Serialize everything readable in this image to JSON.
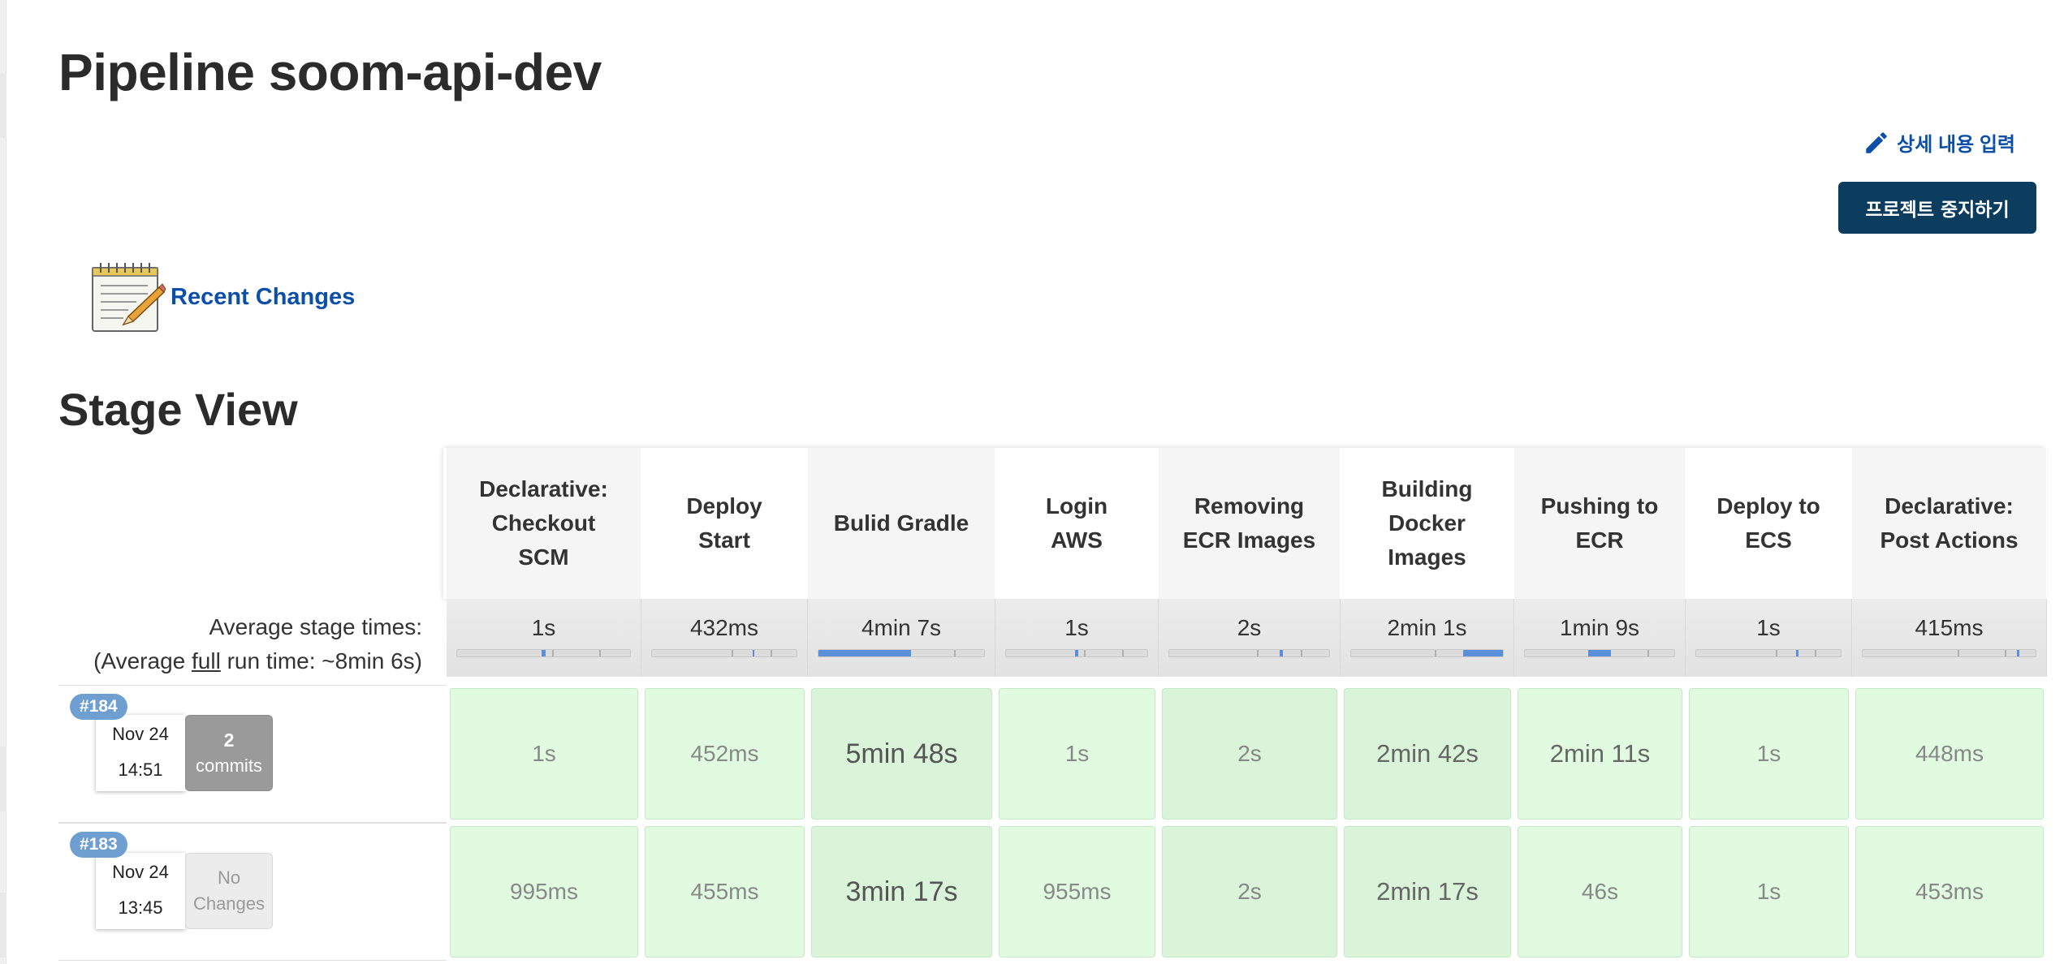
{
  "page": {
    "title": "Pipeline soom-api-dev",
    "edit_link": "상세 내용 입력",
    "stop_button": "프로젝트 중지하기",
    "recent_changes": "Recent Changes",
    "stage_view_title": "Stage View"
  },
  "averages": {
    "label": "Average stage times:",
    "full_prefix": "(Average ",
    "full_word": "full",
    "full_suffix": " run time: ~8min 6s)"
  },
  "stages": [
    {
      "name": "Declarative: Checkout SCM",
      "lines": [
        "Declarative:",
        "Checkout",
        "SCM"
      ],
      "avg": "1s",
      "bar_fill": 0.02
    },
    {
      "name": "Deploy Start",
      "lines": [
        "Deploy",
        "Start"
      ],
      "avg": "432ms",
      "bar_fill": 0.01
    },
    {
      "name": "Bulid Gradle",
      "lines": [
        "Bulid Gradle"
      ],
      "avg": "4min 7s",
      "bar_fill": 0.56
    },
    {
      "name": "Login AWS",
      "lines": [
        "Login",
        "AWS"
      ],
      "avg": "1s",
      "bar_fill": 0.02
    },
    {
      "name": "Removing ECR Images",
      "lines": [
        "Removing",
        "ECR Images"
      ],
      "avg": "2s",
      "bar_fill": 0.02
    },
    {
      "name": "Building Docker Images",
      "lines": [
        "Building",
        "Docker",
        "Images"
      ],
      "avg": "2min 1s",
      "bar_fill": 0.26
    },
    {
      "name": "Pushing to ECR",
      "lines": [
        "Pushing to",
        "ECR"
      ],
      "avg": "1min 9s",
      "bar_fill": 0.15
    },
    {
      "name": "Deploy to ECS",
      "lines": [
        "Deploy to",
        "ECS"
      ],
      "avg": "1s",
      "bar_fill": 0.02
    },
    {
      "name": "Declarative: Post Actions",
      "lines": [
        "Declarative:",
        "Post Actions"
      ],
      "avg": "415ms",
      "bar_fill": 0.01
    }
  ],
  "runs": [
    {
      "number": "#184",
      "date": "Nov 24",
      "time": "14:51",
      "changes_count": "2",
      "changes_label": "commits",
      "has_changes": true,
      "durations": [
        "1s",
        "452ms",
        "5min 48s",
        "1s",
        "2s",
        "2min 42s",
        "2min 11s",
        "1s",
        "448ms"
      ]
    },
    {
      "number": "#183",
      "date": "Nov 24",
      "time": "13:45",
      "changes_count": "",
      "changes_label": "No Changes",
      "has_changes": false,
      "durations": [
        "995ms",
        "455ms",
        "3min 17s",
        "955ms",
        "2s",
        "2min 17s",
        "46s",
        "1s",
        "453ms"
      ]
    }
  ],
  "colors": {
    "link": "#0b4fa8",
    "button_bg": "#0c3c5e",
    "success_cell": "#e0fbe0",
    "progress": "#5b8fd8",
    "badge": "#6f9fd0"
  }
}
